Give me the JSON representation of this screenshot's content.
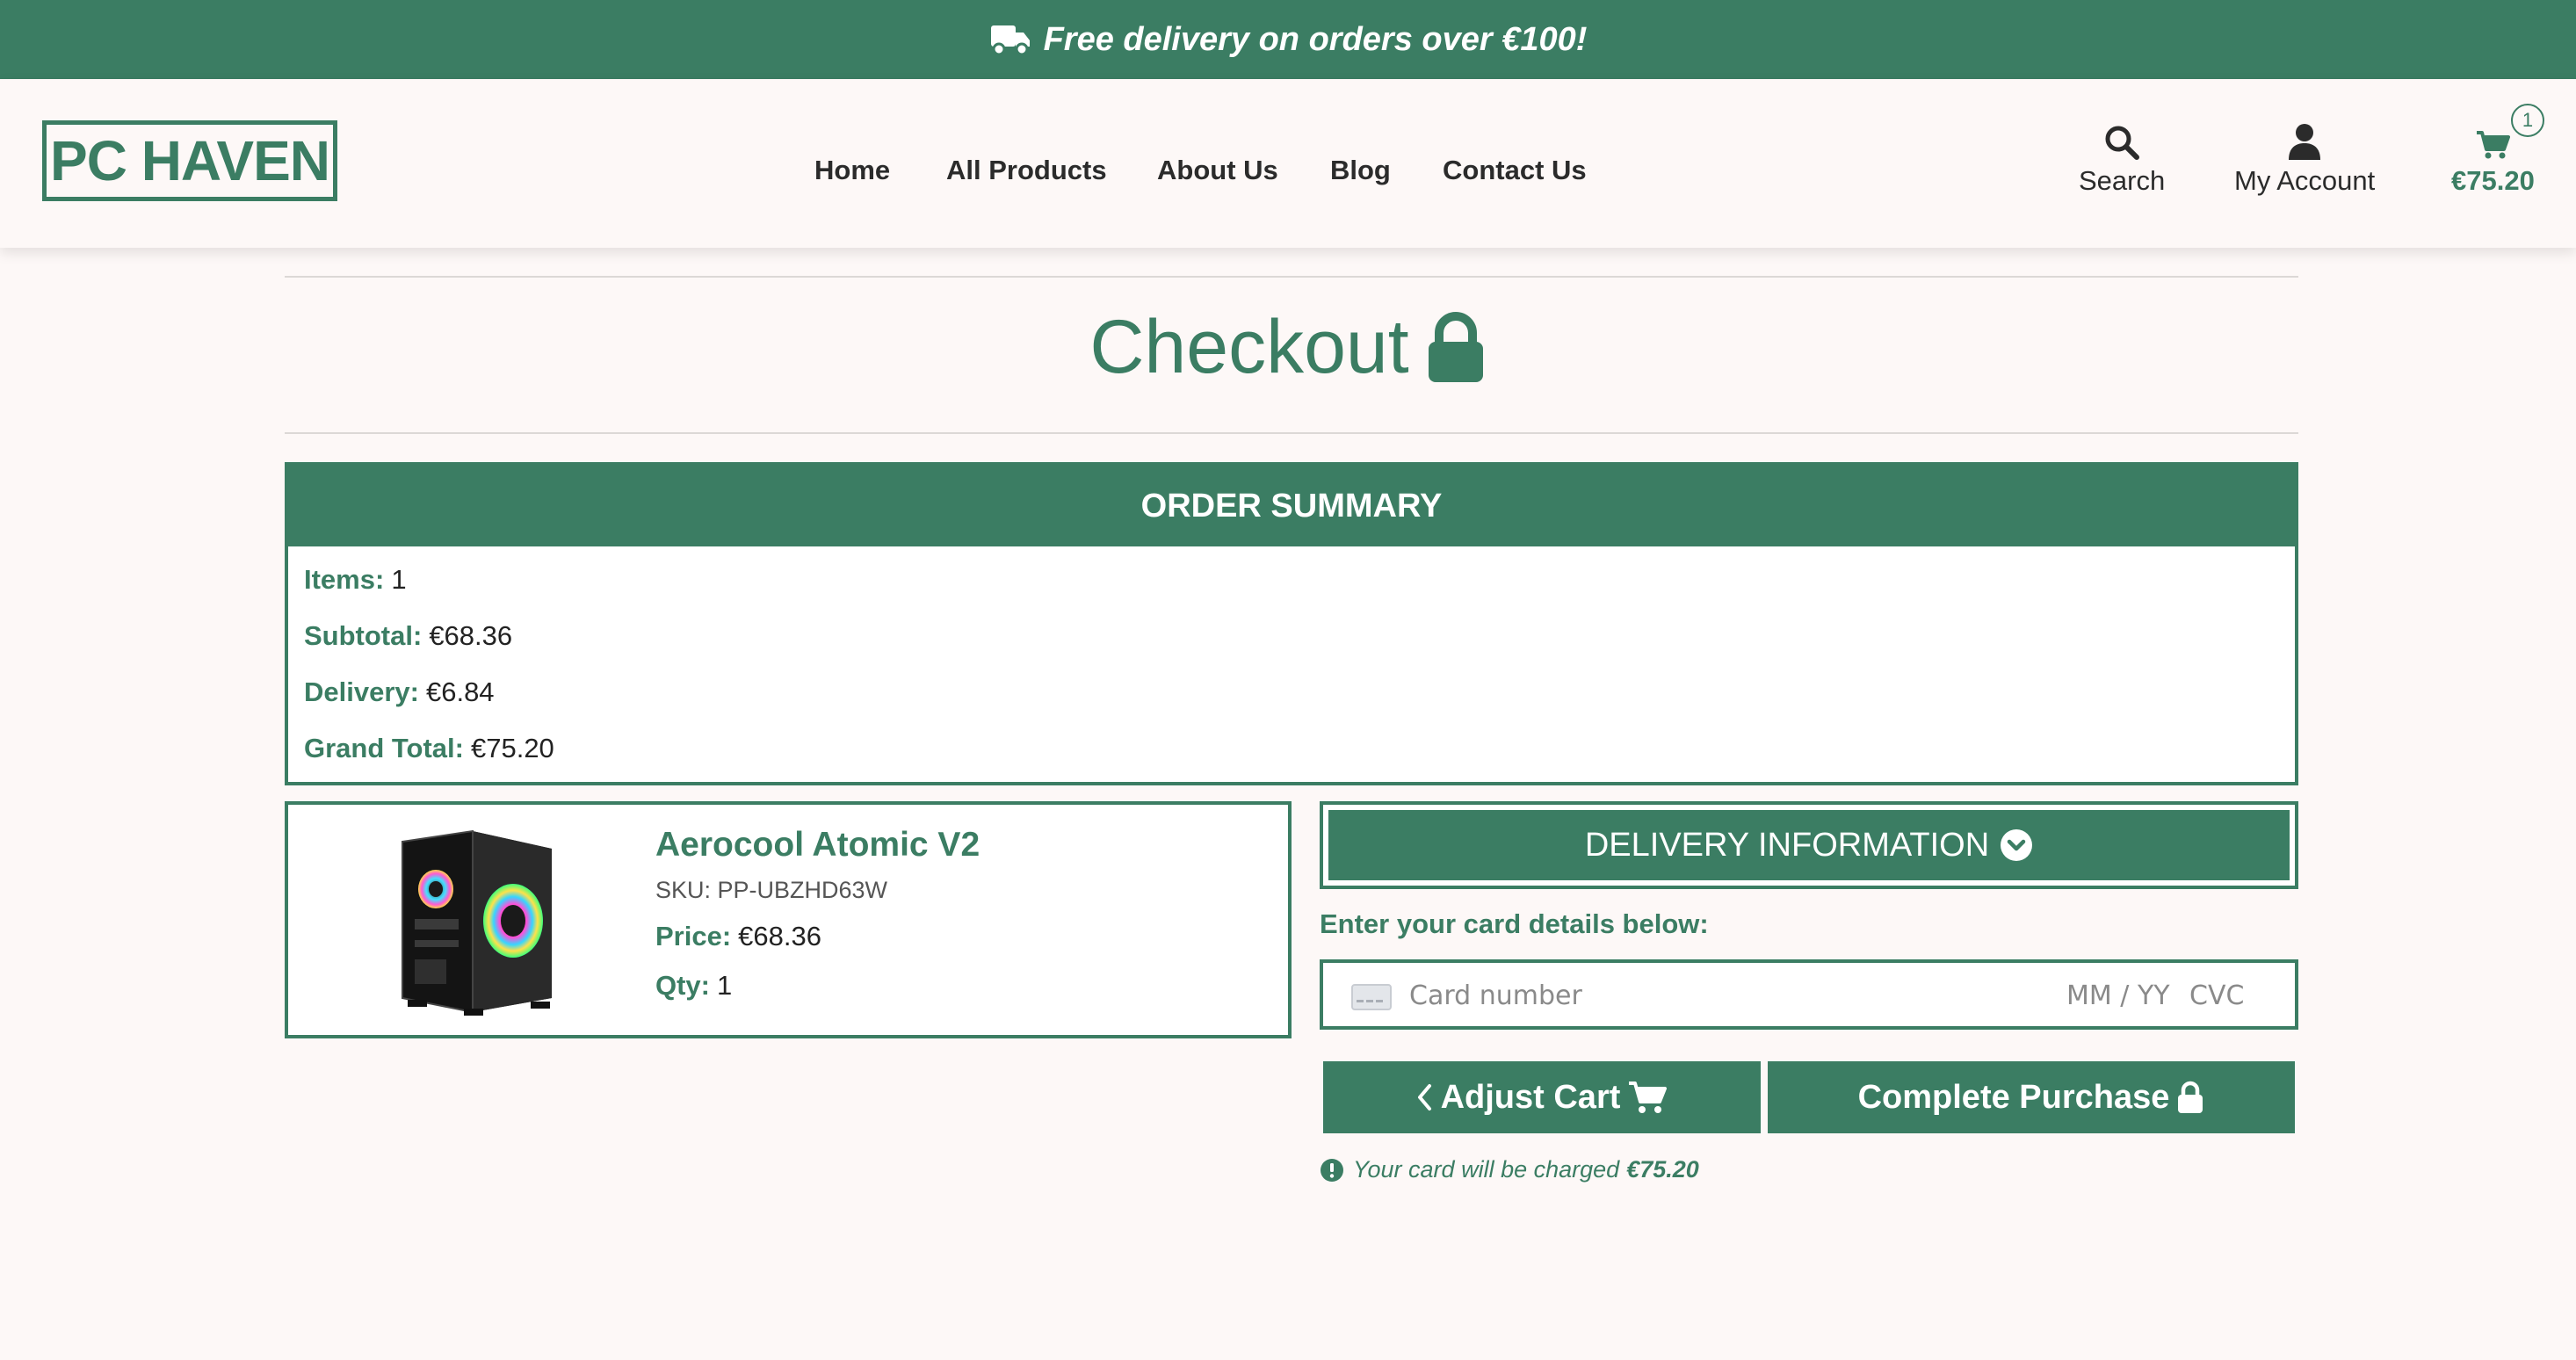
{
  "banner": {
    "text": "Free delivery on orders over €100!",
    "icon": "truck-icon"
  },
  "header": {
    "logo": "PC HAVEN",
    "nav": [
      "Home",
      "All Products",
      "About Us",
      "Blog",
      "Contact Us"
    ],
    "search_label": "Search",
    "account_label": "My Account",
    "cart_total": "€75.20",
    "cart_count": "1"
  },
  "page": {
    "title": "Checkout",
    "title_icon": "lock-icon"
  },
  "summary": {
    "heading": "ORDER SUMMARY",
    "items_label": "Items:",
    "items_value": "1",
    "subtotal_label": "Subtotal:",
    "subtotal_value": "€68.36",
    "delivery_label": "Delivery:",
    "delivery_value": "€6.84",
    "grand_label": "Grand Total:",
    "grand_value": "€75.20"
  },
  "product": {
    "name": "Aerocool Atomic V2",
    "sku": "SKU: PP-UBZHD63W",
    "price_label": "Price:",
    "price_value": "€68.36",
    "qty_label": "Qty:",
    "qty_value": "1"
  },
  "payment": {
    "delivery_button": "DELIVERY INFORMATION",
    "card_prompt": "Enter your card details below:",
    "card_number_placeholder": "Card number",
    "expiry_placeholder": "MM / YY",
    "cvc_placeholder": "CVC",
    "adjust_cart": "Adjust Cart",
    "complete_purchase": "Complete Purchase",
    "charge_note": "Your card will be charged",
    "charge_amount": "€75.20"
  },
  "colors": {
    "brand": "#3b7d63",
    "background": "#fdf8f7"
  }
}
